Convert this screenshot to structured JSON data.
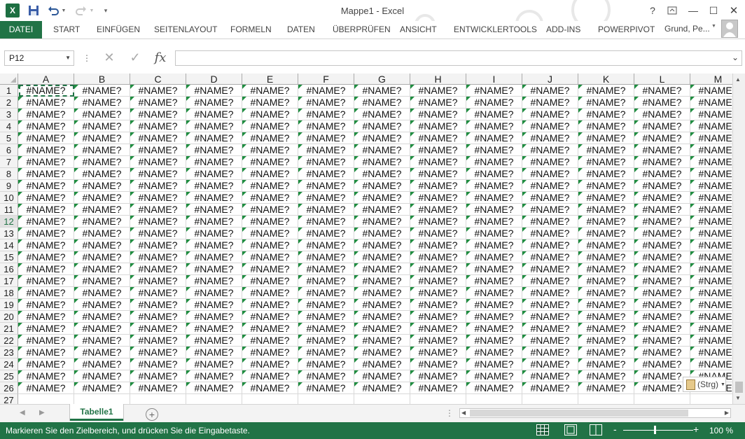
{
  "app": {
    "title": "Mappe1 - Excel",
    "logo": "X",
    "icons": [
      "excel-logo-icon",
      "save-icon",
      "undo-icon",
      "redo-icon",
      "customize-qat-icon",
      "help-icon",
      "ribbon-display-icon",
      "minimize-icon",
      "maximize-icon",
      "close-icon"
    ],
    "help_label": "?",
    "minimize_label": "—",
    "maximize_label": "☐",
    "close_label": "✕"
  },
  "ribbon": {
    "file_tab": "DATEI",
    "tabs": [
      "START",
      "EINFÜGEN",
      "SEITENLAYOUT",
      "FORMELN",
      "DATEN",
      "ÜBERPRÜFEN",
      "ANSICHT",
      "ENTWICKLERTOOLS",
      "ADD-INS",
      "POWERPIVOT"
    ],
    "user": "Grund, Pe...",
    "accent_color": "#217346"
  },
  "formula_bar": {
    "name_box": "P12",
    "cancel_symbol": "✕",
    "enter_symbol": "✓",
    "fx_label": "fx",
    "formula": ""
  },
  "grid": {
    "columns": [
      "A",
      "B",
      "C",
      "D",
      "E",
      "F",
      "G",
      "H",
      "I",
      "J",
      "K",
      "L",
      "M"
    ],
    "rows": [
      "1",
      "2",
      "3",
      "4",
      "5",
      "6",
      "7",
      "8",
      "9",
      "10",
      "11",
      "12",
      "13",
      "14",
      "15",
      "16",
      "17",
      "18",
      "19",
      "20",
      "21",
      "22",
      "23",
      "24",
      "25",
      "26",
      "27"
    ],
    "filled_row_count": 26,
    "cell_value": "#NAME?",
    "selected_row": "12",
    "error_marker_color": "#1f8d40"
  },
  "paste_options": {
    "label": "(Strg)"
  },
  "sheets": {
    "tabs": [
      "Tabelle1"
    ],
    "add_label": "+"
  },
  "status": {
    "message": "Markieren Sie den Zielbereich, und drücken Sie die Eingabetaste.",
    "zoom": "100 %",
    "zoom_minus": "-",
    "zoom_plus": "+"
  }
}
